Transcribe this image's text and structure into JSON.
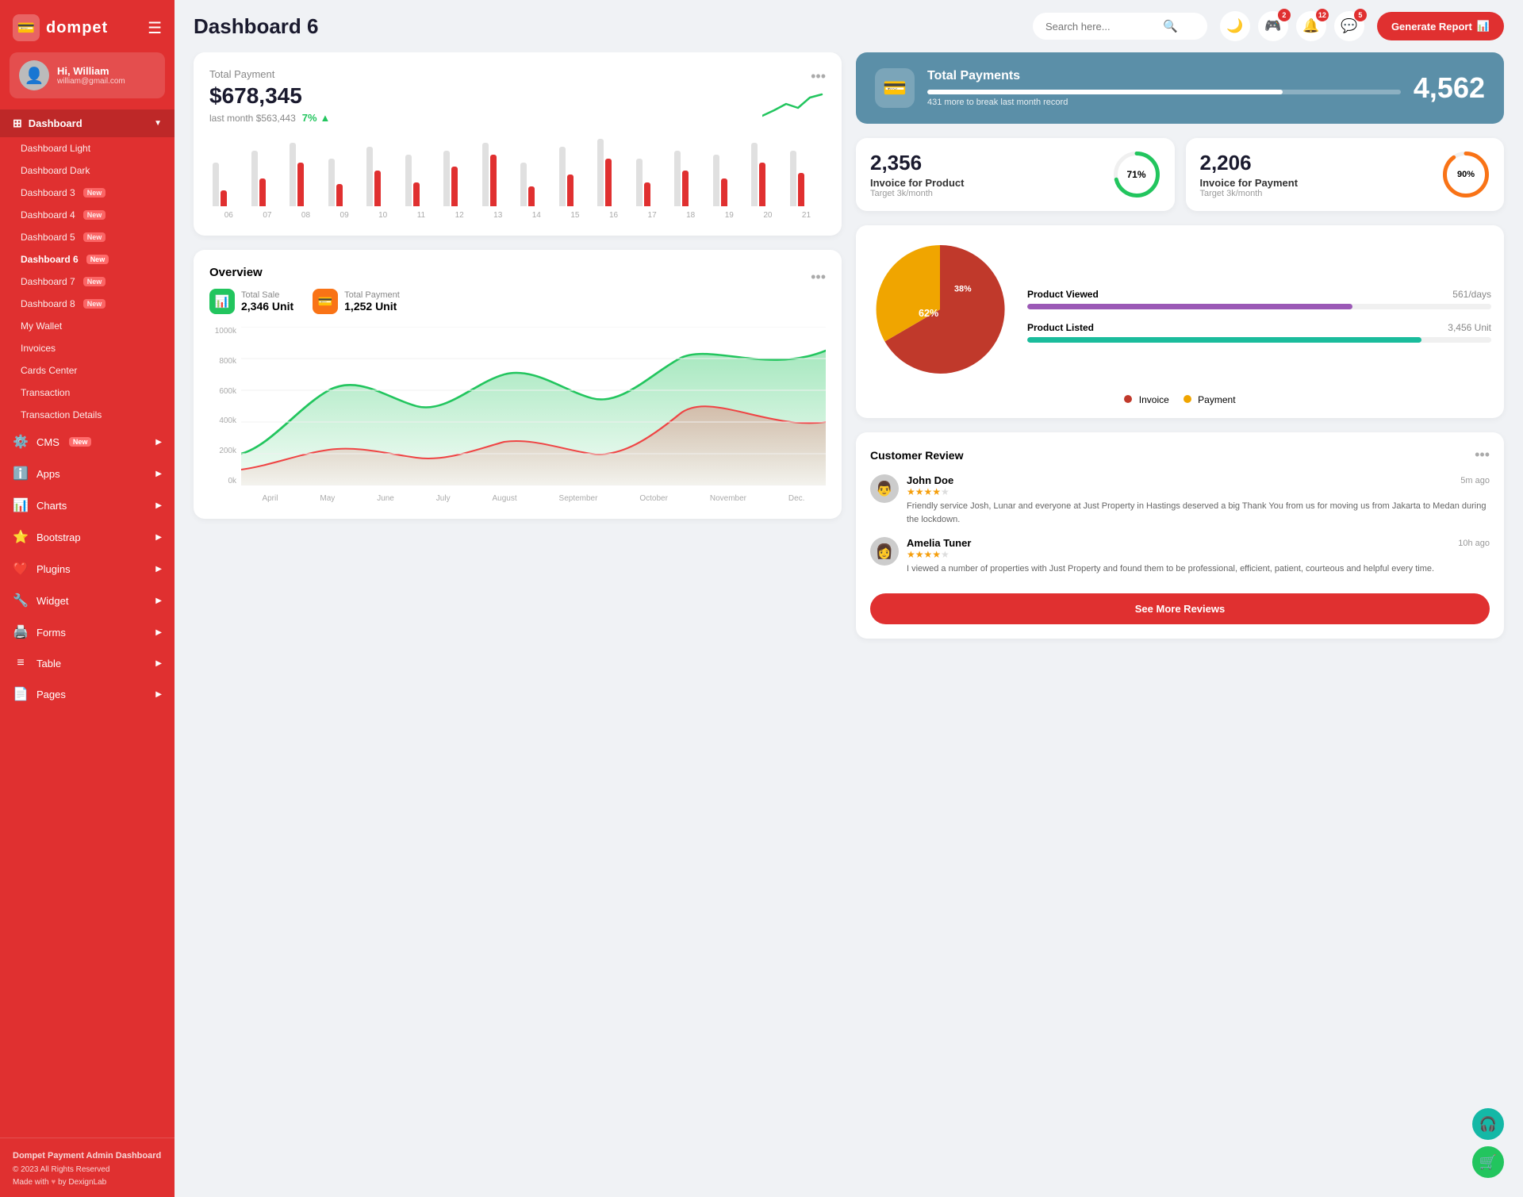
{
  "brand": {
    "logo_icon": "💳",
    "name": "dompet"
  },
  "topbar": {
    "page_title": "Dashboard 6",
    "search_placeholder": "Search here...",
    "generate_btn": "Generate Report",
    "icons": [
      {
        "name": "moon-icon",
        "symbol": "🌙",
        "badge": null
      },
      {
        "name": "gamepad-icon",
        "symbol": "🎮",
        "badge": "2"
      },
      {
        "name": "bell-icon",
        "symbol": "🔔",
        "badge": "12"
      },
      {
        "name": "chat-icon",
        "symbol": "💬",
        "badge": "5"
      }
    ]
  },
  "user": {
    "greeting": "Hi, William",
    "email": "william@gmail.com",
    "avatar": "👤"
  },
  "sidebar": {
    "dashboard_label": "Dashboard",
    "nav_items": [
      {
        "label": "Dashboard Light",
        "badge": null
      },
      {
        "label": "Dashboard Dark",
        "badge": null
      },
      {
        "label": "Dashboard 3",
        "badge": "New"
      },
      {
        "label": "Dashboard 4",
        "badge": "New"
      },
      {
        "label": "Dashboard 5",
        "badge": "New"
      },
      {
        "label": "Dashboard 6",
        "badge": "New",
        "active": true
      },
      {
        "label": "Dashboard 7",
        "badge": "New"
      },
      {
        "label": "Dashboard 8",
        "badge": "New"
      },
      {
        "label": "My Wallet",
        "badge": null
      },
      {
        "label": "Invoices",
        "badge": null
      },
      {
        "label": "Cards Center",
        "badge": null
      },
      {
        "label": "Transaction",
        "badge": null
      },
      {
        "label": "Transaction Details",
        "badge": null
      }
    ],
    "main_nav": [
      {
        "label": "CMS",
        "badge": "New",
        "icon": "⚙️"
      },
      {
        "label": "Apps",
        "badge": null,
        "icon": "ℹ️"
      },
      {
        "label": "Charts",
        "badge": null,
        "icon": "📊"
      },
      {
        "label": "Bootstrap",
        "badge": null,
        "icon": "⭐"
      },
      {
        "label": "Plugins",
        "badge": null,
        "icon": "❤️"
      },
      {
        "label": "Widget",
        "badge": null,
        "icon": "🔧"
      },
      {
        "label": "Forms",
        "badge": null,
        "icon": "🖨️"
      },
      {
        "label": "Table",
        "badge": null,
        "icon": "≡"
      },
      {
        "label": "Pages",
        "badge": null,
        "icon": "📄"
      }
    ],
    "footer": {
      "title": "Dompet Payment Admin Dashboard",
      "copy": "© 2023 All Rights Reserved",
      "made_with": "Made with",
      "by": "by DexignLab"
    }
  },
  "total_payment": {
    "title": "Total Payment",
    "amount": "$678,345",
    "last_month_label": "last month $563,443",
    "trend_pct": "7%",
    "bars": [
      {
        "gray": 55,
        "red": 20
      },
      {
        "gray": 70,
        "red": 35
      },
      {
        "gray": 80,
        "red": 55
      },
      {
        "gray": 60,
        "red": 28
      },
      {
        "gray": 75,
        "red": 45
      },
      {
        "gray": 65,
        "red": 30
      },
      {
        "gray": 70,
        "red": 50
      },
      {
        "gray": 80,
        "red": 65
      },
      {
        "gray": 55,
        "red": 25
      },
      {
        "gray": 75,
        "red": 40
      },
      {
        "gray": 85,
        "red": 60
      },
      {
        "gray": 60,
        "red": 30
      },
      {
        "gray": 70,
        "red": 45
      },
      {
        "gray": 65,
        "red": 35
      },
      {
        "gray": 80,
        "red": 55
      },
      {
        "gray": 70,
        "red": 42
      }
    ],
    "bar_labels": [
      "06",
      "07",
      "08",
      "09",
      "10",
      "11",
      "12",
      "13",
      "14",
      "15",
      "16",
      "17",
      "18",
      "19",
      "20",
      "21"
    ]
  },
  "overview": {
    "title": "Overview",
    "total_sale_label": "Total Sale",
    "total_sale_value": "2,346 Unit",
    "total_payment_label": "Total Payment",
    "total_payment_value": "1,252 Unit",
    "y_labels": [
      "1000k",
      "800k",
      "600k",
      "400k",
      "200k",
      "0k"
    ],
    "x_labels": [
      "April",
      "May",
      "June",
      "July",
      "August",
      "September",
      "October",
      "November",
      "Dec."
    ]
  },
  "total_payments_banner": {
    "title": "Total Payments",
    "sub": "431 more to break last month record",
    "number": "4,562",
    "progress": 75
  },
  "invoice_product": {
    "number": "2,356",
    "label": "Invoice for Product",
    "sub": "Target 3k/month",
    "pct": 71,
    "color": "#22c55e"
  },
  "invoice_payment": {
    "number": "2,206",
    "label": "Invoice for Payment",
    "sub": "Target 3k/month",
    "pct": 90,
    "color": "#f97316"
  },
  "pie_chart": {
    "invoice_pct": 62,
    "payment_pct": 38,
    "invoice_color": "#c0392b",
    "payment_color": "#f0a500",
    "invoice_label": "Invoice",
    "payment_label": "Payment"
  },
  "products": [
    {
      "name": "Product Viewed",
      "value": "561/days",
      "pct": 70,
      "color": "#9b59b6"
    },
    {
      "name": "Product Listed",
      "value": "3,456 Unit",
      "pct": 85,
      "color": "#1abc9c"
    }
  ],
  "reviews": {
    "title": "Customer Review",
    "items": [
      {
        "name": "John Doe",
        "time": "5m ago",
        "stars": 4,
        "text": "Friendly service Josh, Lunar and everyone at Just Property in Hastings deserved a big Thank You from us for moving us from Jakarta to Medan during the lockdown.",
        "avatar": "👨"
      },
      {
        "name": "Amelia Tuner",
        "time": "10h ago",
        "stars": 4,
        "text": "I viewed a number of properties with Just Property and found them to be professional, efficient, patient, courteous and helpful every time.",
        "avatar": "👩"
      }
    ],
    "see_more_label": "See More Reviews"
  },
  "floating": {
    "support_icon": "🎧",
    "cart_icon": "🛒"
  }
}
